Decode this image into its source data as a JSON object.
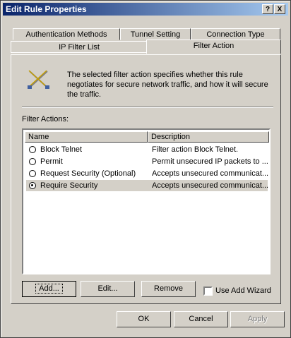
{
  "window": {
    "title": "Edit Rule Properties",
    "help_btn": "?",
    "close_btn": "X"
  },
  "tabs": [
    {
      "label": "Authentication Methods"
    },
    {
      "label": "Tunnel Setting"
    },
    {
      "label": "Connection Type"
    },
    {
      "label": "IP Filter List"
    },
    {
      "label": "Filter Action"
    }
  ],
  "intro_text": "The selected filter action specifies whether this rule negotiates for secure network traffic, and how it will secure the traffic.",
  "filter_actions_label": "Filter Actions:",
  "list": {
    "columns": [
      "Name",
      "Description"
    ],
    "rows": [
      {
        "name": "Block Telnet",
        "description": "Filter action Block Telnet.",
        "selected": false
      },
      {
        "name": "Permit",
        "description": "Permit unsecured IP packets to ...",
        "selected": false
      },
      {
        "name": "Request Security (Optional)",
        "description": "Accepts unsecured communicat...",
        "selected": false
      },
      {
        "name": "Require Security",
        "description": "Accepts unsecured communicat...",
        "selected": true
      }
    ]
  },
  "buttons": {
    "add": "Add...",
    "edit": "Edit...",
    "remove": "Remove",
    "ok": "OK",
    "cancel": "Cancel",
    "apply": "Apply"
  },
  "wizard_checkbox": {
    "label": "Use Add Wizard",
    "checked": false
  }
}
